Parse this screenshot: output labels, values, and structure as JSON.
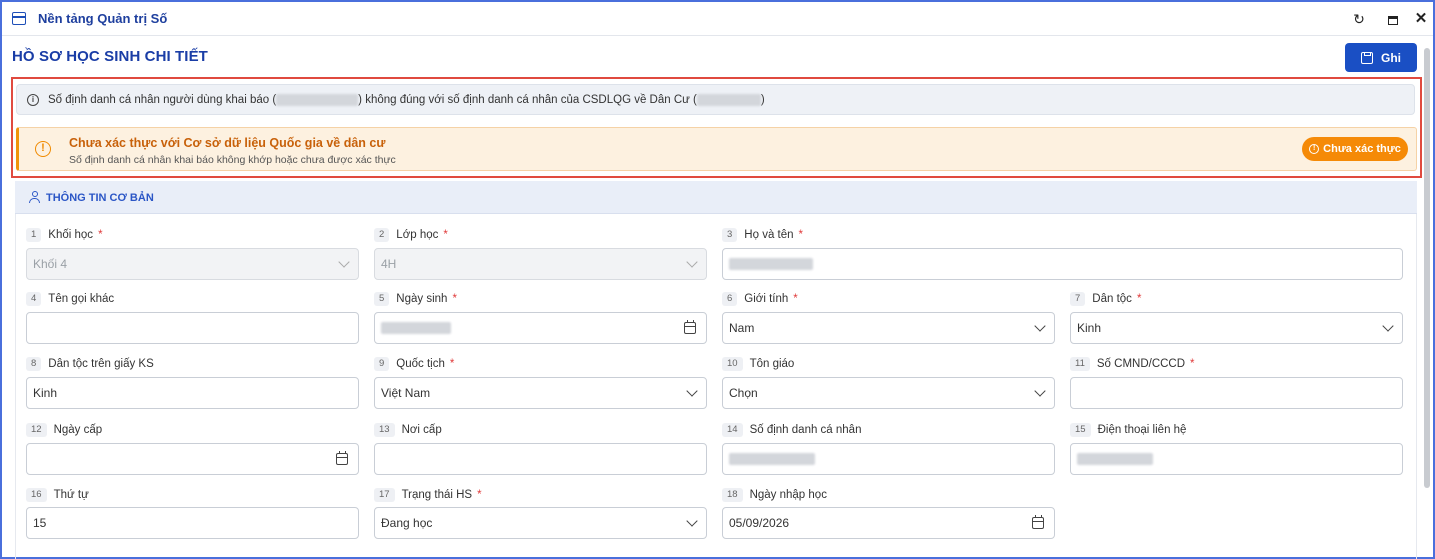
{
  "window": {
    "title": "Nền tảng Quản trị Số",
    "refresh_icon": "refresh-icon",
    "maximize_icon": "maximize-icon",
    "close_icon": "close-icon"
  },
  "page": {
    "title": "HỒ SƠ HỌC SINH CHI TIẾT",
    "save_label": "Ghi"
  },
  "info_bar": {
    "text_part1": "Số định danh cá nhân người dùng khai báo (",
    "text_part2": ") không đúng với số định danh cá nhân của CSDLQG về Dân Cư (",
    "text_part3": ")"
  },
  "warning": {
    "title": "Chưa xác thực với Cơ sở dữ liệu Quốc gia về dân cư",
    "subtitle": "Số định danh cá nhân khai báo không khớp hoặc chưa được xác thực",
    "status_label": "Chưa xác thực",
    "color": "#f58a07"
  },
  "section": {
    "title": "THÔNG TIN CƠ BẢN"
  },
  "fields": {
    "f1": {
      "num": "1",
      "label": "Khối học",
      "required": "*",
      "value": "Khối 4"
    },
    "f2": {
      "num": "2",
      "label": "Lớp học",
      "required": "*",
      "value": "4H"
    },
    "f3": {
      "num": "3",
      "label": "Họ và tên",
      "required": "*",
      "value": ""
    },
    "f4": {
      "num": "4",
      "label": "Tên gọi khác",
      "value": ""
    },
    "f5": {
      "num": "5",
      "label": "Ngày sinh",
      "required": "*",
      "value": ""
    },
    "f6": {
      "num": "6",
      "label": "Giới tính",
      "required": "*",
      "value": "Nam"
    },
    "f7": {
      "num": "7",
      "label": "Dân tộc",
      "required": "*",
      "value": "Kinh"
    },
    "f8": {
      "num": "8",
      "label": "Dân tộc trên giấy KS",
      "value": "Kinh"
    },
    "f9": {
      "num": "9",
      "label": "Quốc tịch",
      "required": "*",
      "value": "Việt Nam"
    },
    "f10": {
      "num": "10",
      "label": "Tôn giáo",
      "value": "Chọn"
    },
    "f11": {
      "num": "11",
      "label": "Số CMND/CCCD",
      "required": "*",
      "value": ""
    },
    "f12": {
      "num": "12",
      "label": "Ngày cấp",
      "value": ""
    },
    "f13": {
      "num": "13",
      "label": "Nơi cấp",
      "value": ""
    },
    "f14": {
      "num": "14",
      "label": "Số định danh cá nhân",
      "value": ""
    },
    "f15": {
      "num": "15",
      "label": "Điện thoại liên hệ",
      "value": ""
    },
    "f16": {
      "num": "16",
      "label": "Thứ tự",
      "value": "15"
    },
    "f17": {
      "num": "17",
      "label": "Trạng thái HS",
      "required": "*",
      "value": "Đang học"
    },
    "f18": {
      "num": "18",
      "label": "Ngày nhập học",
      "value": "05/09/2026"
    }
  }
}
